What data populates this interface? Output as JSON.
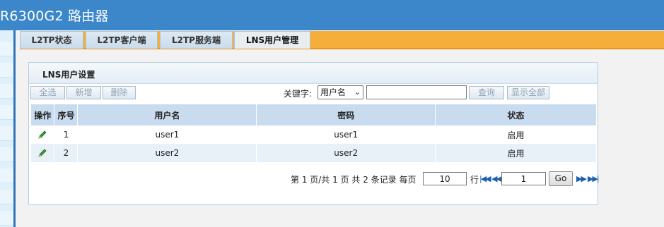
{
  "app": {
    "title": "R6300G2 路由器"
  },
  "tabs": [
    {
      "label": "L2TP状态",
      "active": false
    },
    {
      "label": "L2TP客户端",
      "active": false
    },
    {
      "label": "L2TP服务端",
      "active": false
    },
    {
      "label": "LNS用户管理",
      "active": true
    }
  ],
  "panel": {
    "title": "LNS用户设置"
  },
  "toolbar": {
    "select_all": "全选",
    "add": "新增",
    "delete": "删除",
    "keyword_label": "关键字:",
    "keyword_select": "用户名",
    "keyword_value": "",
    "search": "查询",
    "show_all": "显示全部"
  },
  "table": {
    "headers": [
      "操作",
      "序号",
      "用户名",
      "密码",
      "状态"
    ],
    "rows": [
      {
        "index": "1",
        "username": "user1",
        "password": "user1",
        "status": "启用"
      },
      {
        "index": "2",
        "username": "user2",
        "password": "user2",
        "status": "启用"
      }
    ]
  },
  "pager": {
    "summary": "第 1 页/共 1 页 共 2 条记录 每页",
    "per_page": "10",
    "row_unit": "行",
    "page_input": "1",
    "go": "Go"
  },
  "icons": {
    "edit": "pencil-icon",
    "first": "first-page-icon",
    "prev": "prev-page-icon",
    "next": "next-page-icon",
    "last": "last-page-icon"
  },
  "colors": {
    "header": "#3b87c9",
    "tabbar": "#f5ae3a",
    "table_header": "#c9dcef",
    "row_alt": "#e8f0f8",
    "nav_icon": "#1a5fb0"
  }
}
